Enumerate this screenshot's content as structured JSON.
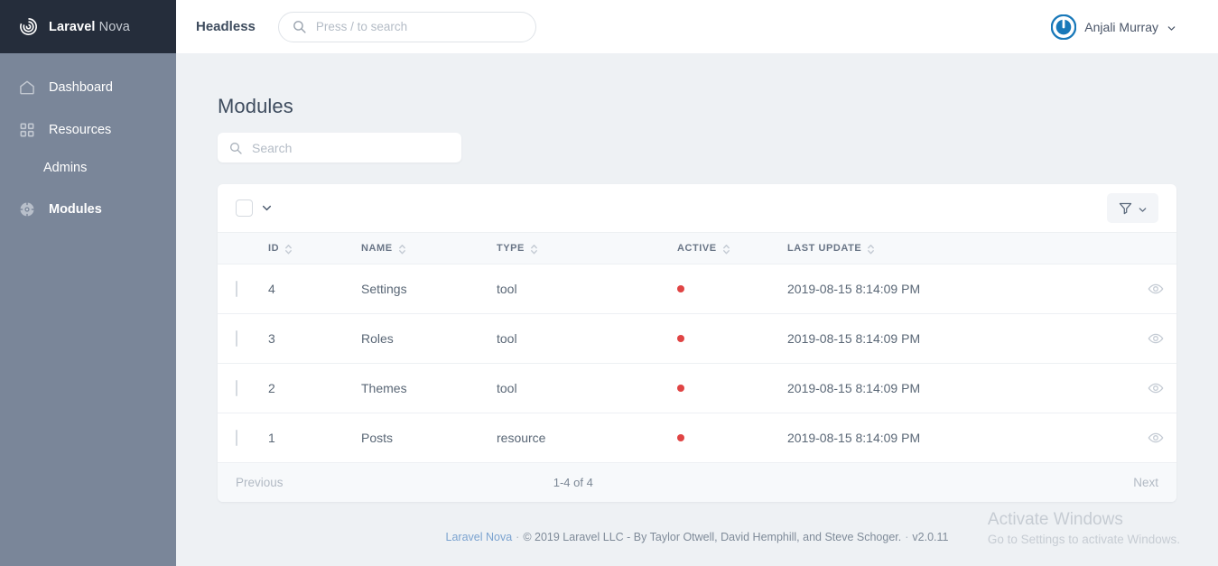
{
  "brand": {
    "strong": "Laravel",
    "light": "Nova",
    "logo_icon": "nova-spiral-icon"
  },
  "sidebar": {
    "items": [
      {
        "label": "Dashboard",
        "icon": "home-icon",
        "active": false,
        "sub": false
      },
      {
        "label": "Resources",
        "icon": "grid-icon",
        "active": false,
        "sub": false
      },
      {
        "label": "Admins",
        "icon": "",
        "active": false,
        "sub": true
      },
      {
        "label": "Modules",
        "icon": "lifebuoy-icon",
        "active": true,
        "sub": false
      }
    ]
  },
  "topbar": {
    "app_name": "Headless",
    "search_placeholder": "Press / to search",
    "search_value": "",
    "search_icon": "search-icon",
    "user_name": "Anjali Murray",
    "avatar_icon": "gravatar-avatar-icon",
    "caret_icon": "chevron-down-icon"
  },
  "page": {
    "title": "Modules",
    "search_placeholder": "Search",
    "search_value": "",
    "search_icon": "search-icon"
  },
  "toolbar": {
    "select_all_checked": false,
    "select_caret_icon": "chevron-down-icon",
    "filter_icon": "filter-funnel-icon",
    "filter_caret_icon": "chevron-down-icon"
  },
  "table": {
    "columns": [
      {
        "key": "id",
        "label": "ID",
        "sortable": true
      },
      {
        "key": "name",
        "label": "NAME",
        "sortable": true
      },
      {
        "key": "type",
        "label": "TYPE",
        "sortable": true
      },
      {
        "key": "active",
        "label": "ACTIVE",
        "sortable": true
      },
      {
        "key": "update",
        "label": "LAST UPDATE",
        "sortable": true
      }
    ],
    "sort_icon": "sort-updown-icon",
    "row_action_icon": "eye-icon",
    "active_dot_color": "#e04444",
    "rows": [
      {
        "id": "4",
        "name": "Settings",
        "type": "tool",
        "active": true,
        "update": "2019-08-15 8:14:09 PM"
      },
      {
        "id": "3",
        "name": "Roles",
        "type": "tool",
        "active": true,
        "update": "2019-08-15 8:14:09 PM"
      },
      {
        "id": "2",
        "name": "Themes",
        "type": "tool",
        "active": true,
        "update": "2019-08-15 8:14:09 PM"
      },
      {
        "id": "1",
        "name": "Posts",
        "type": "resource",
        "active": true,
        "update": "2019-08-15 8:14:09 PM"
      }
    ]
  },
  "pagination": {
    "previous": "Previous",
    "count": "1-4 of 4",
    "next": "Next"
  },
  "footer": {
    "link": "Laravel Nova",
    "copyright": "© 2019 Laravel LLC - By Taylor Otwell, David Hemphill, and Steve Schoger.",
    "version": "v2.0.11",
    "separator": "·"
  },
  "watermark": {
    "title": "Activate Windows",
    "subtitle": "Go to Settings to activate Windows."
  }
}
